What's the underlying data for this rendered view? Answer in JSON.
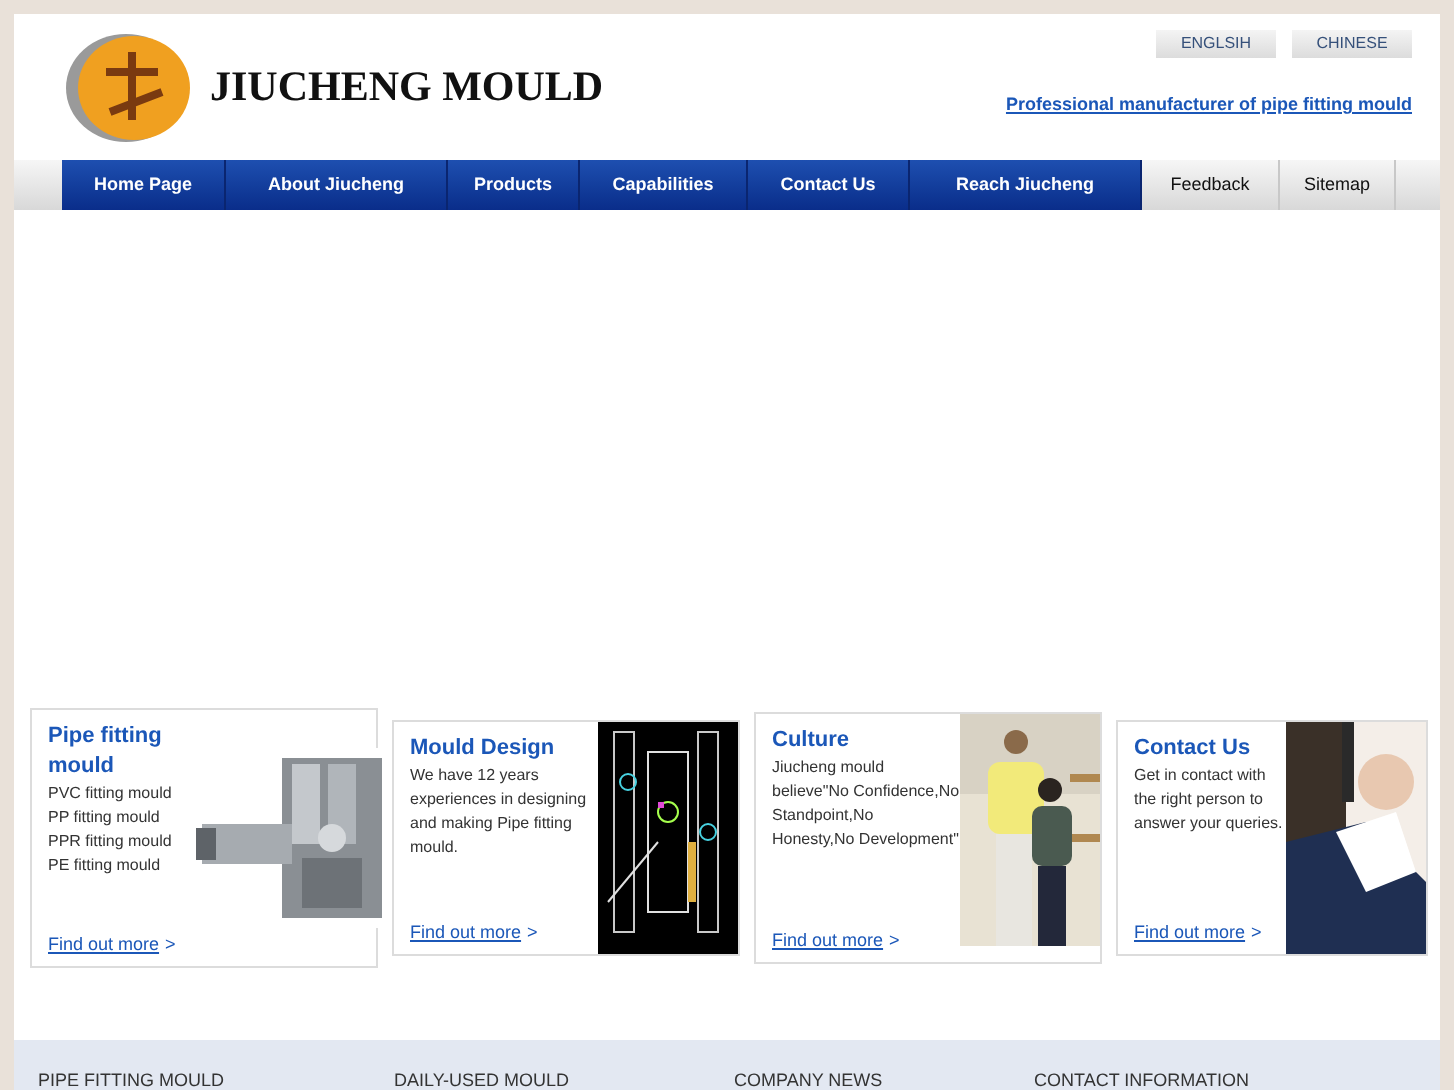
{
  "header": {
    "brand": "JIUCHENG MOULD",
    "languages": [
      {
        "label": "ENGLSIH"
      },
      {
        "label": "CHINESE"
      }
    ],
    "tagline": "Professional manufacturer of pipe fitting mould"
  },
  "nav": [
    {
      "label": "Home Page",
      "kind": "primary"
    },
    {
      "label": "About Jiucheng",
      "kind": "primary"
    },
    {
      "label": "Products",
      "kind": "primary"
    },
    {
      "label": "Capabilities",
      "kind": "primary"
    },
    {
      "label": "Contact Us",
      "kind": "primary"
    },
    {
      "label": "Reach Jiucheng",
      "kind": "primary"
    },
    {
      "label": "Feedback",
      "kind": "secondary"
    },
    {
      "label": "Sitemap",
      "kind": "secondary"
    }
  ],
  "cards": [
    {
      "title": "Pipe fitting mould",
      "kind": "list",
      "lines": [
        "PVC fitting mould",
        "PP fitting mould",
        "PPR fitting mould",
        "PE fitting mould"
      ],
      "link": "Find out more",
      "arrow": ">"
    },
    {
      "title": "Mould Design",
      "kind": "text",
      "text": "We have 12 years experiences in designing and making Pipe fitting mould.",
      "link": "Find out more",
      "arrow": ">"
    },
    {
      "title": "Culture",
      "kind": "text",
      "text": "Jiucheng mould believe\"No Confidence,No Standpoint,No Honesty,No Development\"",
      "link": "Find out more",
      "arrow": ">"
    },
    {
      "title": "Contact Us",
      "kind": "text",
      "text": "Get in contact with the right person to answer your queries.",
      "link": "Find out more",
      "arrow": ">"
    }
  ],
  "footer": {
    "headings": [
      "PIPE FITTING MOULD",
      "DAILY-USED MOULD",
      "COMPANY NEWS",
      "CONTACT INFORMATION"
    ]
  }
}
